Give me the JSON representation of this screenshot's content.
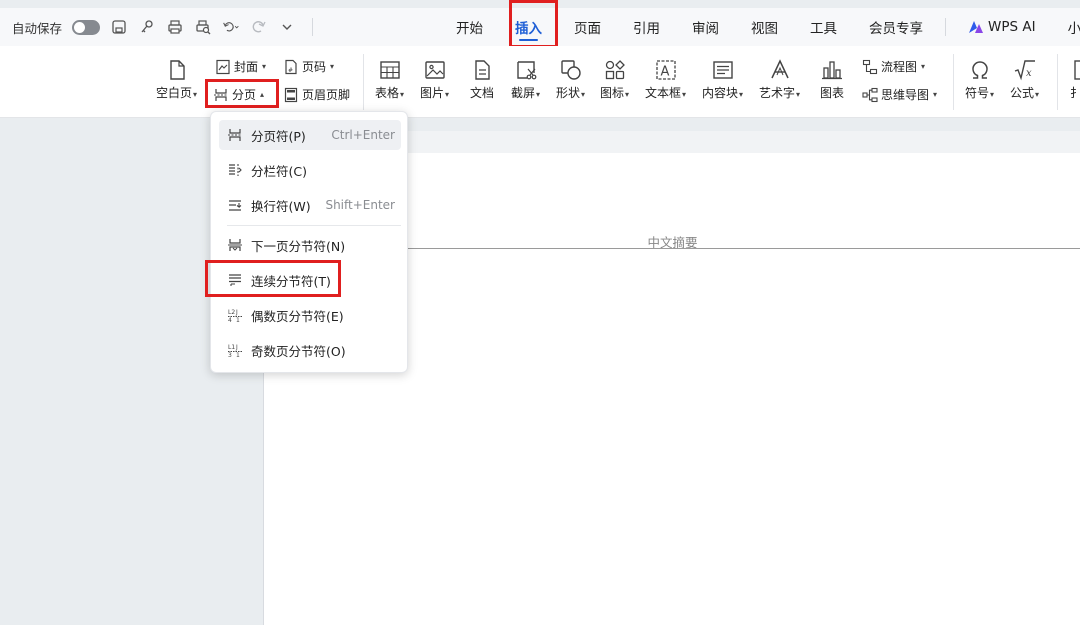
{
  "quick_access": {
    "autosave_label": "自动保存",
    "icons": [
      "save-icon",
      "key-icon",
      "print-icon",
      "print-preview-icon",
      "undo-icon",
      "redo-icon",
      "more-icon"
    ]
  },
  "tabs": [
    {
      "label": "开始",
      "active": false
    },
    {
      "label": "插入",
      "active": true
    },
    {
      "label": "页面",
      "active": false
    },
    {
      "label": "引用",
      "active": false
    },
    {
      "label": "审阅",
      "active": false
    },
    {
      "label": "视图",
      "active": false
    },
    {
      "label": "工具",
      "active": false
    },
    {
      "label": "会员专享",
      "active": false
    },
    {
      "label": "WPS AI",
      "active": false
    },
    {
      "label": "小绿",
      "active": false
    }
  ],
  "ribbon": {
    "blank_page": "空白页",
    "cover": "封面",
    "page_break": "分页",
    "page_number": "页码",
    "header_footer": "页眉页脚",
    "table": "表格",
    "picture": "图片",
    "document": "文档",
    "screenshot": "截屏",
    "shape": "形状",
    "icon": "图标",
    "textbox": "文本框",
    "content_block": "内容块",
    "wordart": "艺术字",
    "chart": "图表",
    "flowchart": "流程图",
    "mindmap": "思维导图",
    "symbol": "符号",
    "formula": "公式",
    "more": "扌"
  },
  "menu": {
    "items": [
      {
        "label": "分页符(P)",
        "shortcut": "Ctrl+Enter"
      },
      {
        "label": "分栏符(C)",
        "shortcut": ""
      },
      {
        "label": "换行符(W)",
        "shortcut": "Shift+Enter"
      },
      {
        "label": "下一页分节符(N)",
        "shortcut": ""
      },
      {
        "label": "连续分节符(T)",
        "shortcut": ""
      },
      {
        "label": "偶数页分节符(E)",
        "shortcut": ""
      },
      {
        "label": "奇数页分节符(O)",
        "shortcut": ""
      }
    ]
  },
  "document": {
    "header_text": "中文摘要"
  },
  "colors": {
    "accent": "#1f5fd6",
    "highlight": "#e01f1f"
  }
}
